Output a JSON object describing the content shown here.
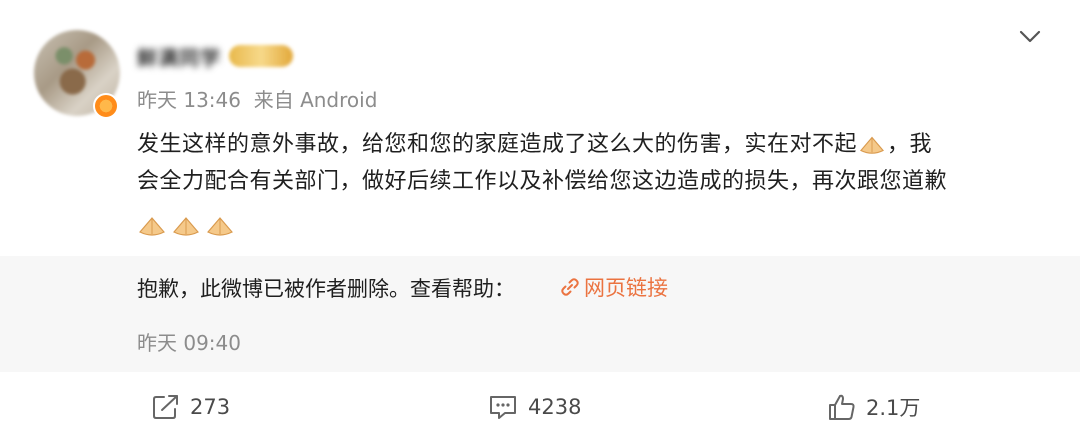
{
  "author": {
    "name": "鲜满同学",
    "vip_badge_icon": "vip-crown-badge"
  },
  "post": {
    "meta": "昨天 13:46  来自 Android",
    "text_line1": "发生这样的意外事故，给您和您的家庭造成了这么大的伤害，实在对不起",
    "text_line1_tail": "，我",
    "text_line2": "会全力配合有关部门，做好后续工作以及补偿给您这边造成的损失，再次跟您道歉",
    "emoji_icon": "folded-hands-icon"
  },
  "repost": {
    "deleted_text": "抱歉，此微博已被作者删除。查看帮助：",
    "link_label": "网页链接",
    "time": "昨天 09:40"
  },
  "actions": {
    "forward_count": "273",
    "comment_count": "4238",
    "like_count": "2.1万"
  },
  "colors": {
    "link": "#eb7340",
    "meta_gray": "#8c8c8c",
    "repost_bg": "#f7f7f7"
  }
}
